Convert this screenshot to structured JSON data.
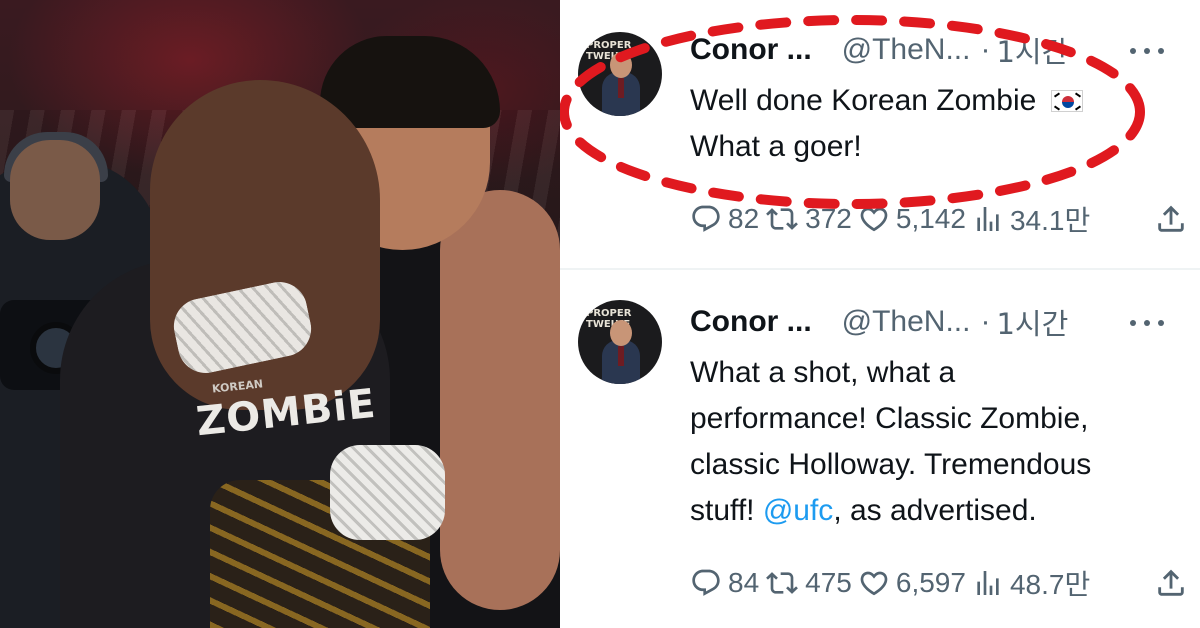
{
  "photo": {
    "shirt_text": "ZOMBiE",
    "shirt_subtext": "KOREAN"
  },
  "tweets": [
    {
      "name": "Conor ...",
      "handle": "@TheN...",
      "separator": "·",
      "time": "1시간",
      "text_line1": "Well done Korean Zombie",
      "text_line2": "What a goer!",
      "flag_icon": "south-korea-flag-icon",
      "replies": "82",
      "reposts": "372",
      "likes": "5,142",
      "views": "34.1만",
      "highlighted": true,
      "highlight_color": "#e0191f"
    },
    {
      "name": "Conor ...",
      "handle": "@TheN...",
      "separator": "·",
      "time": "1시간",
      "text_line1": "What a shot, what a",
      "text_line2": "performance! Classic Zombie,",
      "text_line3": "classic Holloway. Tremendous",
      "text_line4_before": "stuff! ",
      "mention": "@ufc",
      "text_line4_after": ", as advertised.",
      "replies": "84",
      "reposts": "475",
      "likes": "6,597",
      "views": "48.7만"
    }
  ],
  "colors": {
    "text": "#0f1419",
    "secondary": "#536471",
    "link": "#1d9bf0",
    "border": "#eff3f4"
  },
  "icons": [
    "reply-icon",
    "repost-icon",
    "like-icon",
    "views-icon",
    "share-icon",
    "more-icon"
  ]
}
